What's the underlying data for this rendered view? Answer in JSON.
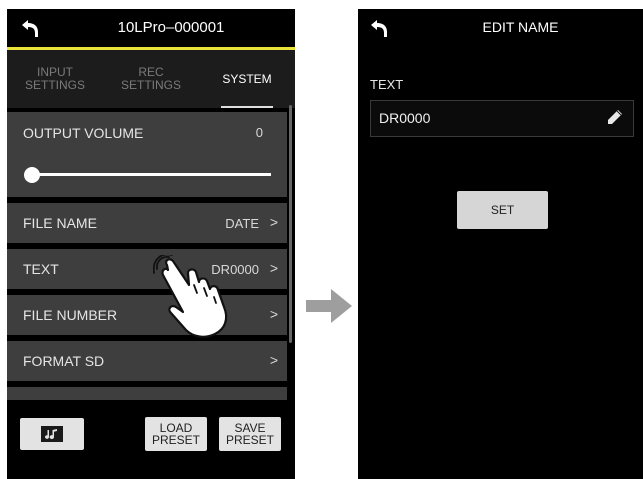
{
  "left_screen": {
    "title": "10LPro–000001",
    "tabs": [
      {
        "label": "INPUT SETTINGS",
        "active": false
      },
      {
        "label": "REC SETTINGS",
        "active": false
      },
      {
        "label": "SYSTEM",
        "active": true
      }
    ],
    "output_volume": {
      "label": "OUTPUT VOLUME",
      "value": "0",
      "slider_level": 0
    },
    "rows": [
      {
        "label": "FILE NAME",
        "value": "DATE"
      },
      {
        "label": "TEXT",
        "value": "DR0000"
      },
      {
        "label": "FILE NUMBER",
        "value": ""
      },
      {
        "label": "FORMAT SD",
        "value": ""
      }
    ],
    "buttons": {
      "music_icon": "music-note-icon",
      "load_preset": "LOAD PRESET",
      "save_preset": "SAVE PRESET"
    }
  },
  "right_screen": {
    "title": "EDIT NAME",
    "field_label": "TEXT",
    "field_value": "DR0000",
    "set_label": "SET"
  },
  "colors": {
    "accent_yellow": "#e8e23a",
    "row_bg": "#3e3e3e",
    "screen_bg": "#000000",
    "arrow": "#9e9e9e"
  }
}
